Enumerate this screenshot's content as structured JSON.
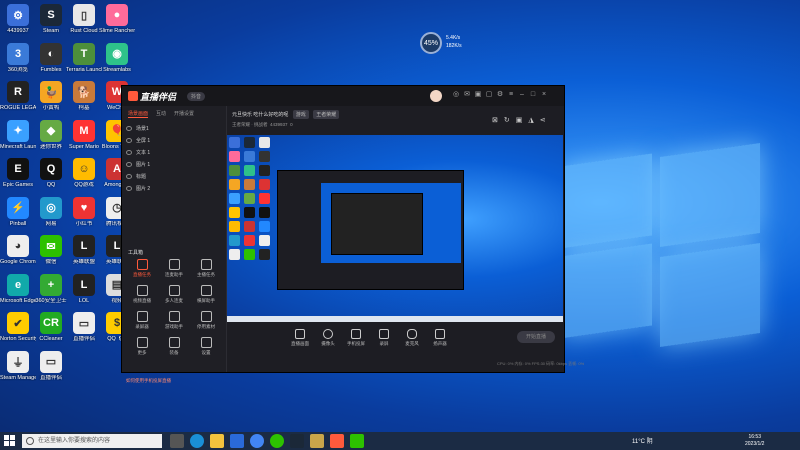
{
  "desktop": {
    "icons": [
      {
        "label": "4439937",
        "color": "#3b6fd9",
        "glyph": "⚙"
      },
      {
        "label": "Steam",
        "color": "#1b2838",
        "glyph": "S"
      },
      {
        "label": "Rust Cloud",
        "color": "#e8e8e8",
        "glyph": "▯"
      },
      {
        "label": "Slime Rancher",
        "color": "#ff6b9a",
        "glyph": "●"
      },
      {
        "label": "360浏览",
        "color": "#3a7ad8",
        "glyph": "3"
      },
      {
        "label": "Fumbles",
        "color": "#333",
        "glyph": "◐"
      },
      {
        "label": "Terraria Launcher",
        "color": "#4d8f3b",
        "glyph": "T"
      },
      {
        "label": "Streamlabs",
        "color": "#2ec28a",
        "glyph": "◉"
      },
      {
        "label": "ROGUE LEGACY 2",
        "color": "#222",
        "glyph": "R"
      },
      {
        "label": "小黄鸭",
        "color": "#f5a623",
        "glyph": "🦆"
      },
      {
        "label": "柯基",
        "color": "#c97a3a",
        "glyph": "🐕"
      },
      {
        "label": "WeChat",
        "color": "#d33",
        "glyph": "W"
      },
      {
        "label": "Minecraft Launcher",
        "color": "#3aa0ff",
        "glyph": "✦"
      },
      {
        "label": "迷你世界",
        "color": "#6a4",
        "glyph": "◆"
      },
      {
        "label": "Super Mario",
        "color": "#f33",
        "glyph": "M"
      },
      {
        "label": "Bloons TD 6",
        "color": "#ffc400",
        "glyph": "🎈"
      },
      {
        "label": "Epic Games",
        "color": "#111",
        "glyph": "E"
      },
      {
        "label": "QQ",
        "color": "#111",
        "glyph": "Q"
      },
      {
        "label": "QQ游戏",
        "color": "#fb0",
        "glyph": "☺"
      },
      {
        "label": "Among Us",
        "color": "#c33",
        "glyph": "A"
      },
      {
        "label": "Pinball",
        "color": "#28f",
        "glyph": "⚡"
      },
      {
        "label": "网易",
        "color": "#29c",
        "glyph": "◎"
      },
      {
        "label": "小红书",
        "color": "#e33",
        "glyph": "♥"
      },
      {
        "label": "腾讯视频",
        "color": "#eee",
        "glyph": "◷"
      },
      {
        "label": "Google Chrome",
        "color": "#eee",
        "glyph": "◕"
      },
      {
        "label": "微信",
        "color": "#2dc100",
        "glyph": "✉"
      },
      {
        "label": "英雄联盟",
        "color": "#222",
        "glyph": "L"
      },
      {
        "label": "英雄联盟",
        "color": "#222",
        "glyph": "L"
      },
      {
        "label": "Microsoft Edge",
        "color": "#1aa",
        "glyph": "e"
      },
      {
        "label": "360安全卫士",
        "color": "#3a3",
        "glyph": "+"
      },
      {
        "label": "LOL",
        "color": "#222",
        "glyph": "L"
      },
      {
        "label": "视频",
        "color": "#ddd",
        "glyph": "▤"
      },
      {
        "label": "Norton Security",
        "color": "#fc0",
        "glyph": "✔"
      },
      {
        "label": "CCleaner",
        "color": "#2a2",
        "glyph": "CR"
      },
      {
        "label": "直播伴侣",
        "color": "#eee",
        "glyph": "▭"
      },
      {
        "label": "QQ飞车",
        "color": "#fc0",
        "glyph": "$"
      },
      {
        "label": "Steam Manager",
        "color": "#eee",
        "glyph": "⏚"
      },
      {
        "label": "直播伴侣",
        "color": "#eee",
        "glyph": "▭"
      }
    ]
  },
  "widget": {
    "percent": "45%",
    "up": "5.4K/s",
    "down": "182K/s"
  },
  "app": {
    "title_logo": "直播伴侣",
    "version": "抖音",
    "sidebar": {
      "tabs": [
        "场景画面",
        "互动",
        "开播设置"
      ],
      "scenes": [
        "场景1",
        "全屏 1",
        "文本 1",
        "图片 1",
        "标题",
        "图片 2"
      ],
      "tools_title": "工具箱",
      "tools": [
        "直播任务",
        "连麦助手",
        "主播任务",
        "视频直播",
        "多人连麦",
        "横屏助手",
        "录屏器",
        "游戏助手",
        "停用素材",
        "更多",
        "装备",
        "设置"
      ],
      "notice": "如何使用手机投屏直播"
    },
    "header": {
      "title": "元旦快乐 吃什么好吃的呢",
      "tag": "游戏",
      "pill": "王者荣耀"
    },
    "subheader": {
      "text": "王者荣耀 · 挑战者",
      "follow": "4439937",
      "count": "0"
    },
    "controls": [
      "直播画面",
      "摄像头",
      "手机投屏",
      "录屏",
      "麦克风",
      "扬声器"
    ],
    "live_button": "开始直播",
    "status": "CPU: 0%  内存: 0%  FPS:30  码率: 0kbps  丢帧: 0%"
  },
  "taskbar": {
    "search_placeholder": "在这里输入你要搜索的内容",
    "weather": "11°C 阴",
    "time": "16:53",
    "date": "2023/1/2"
  }
}
